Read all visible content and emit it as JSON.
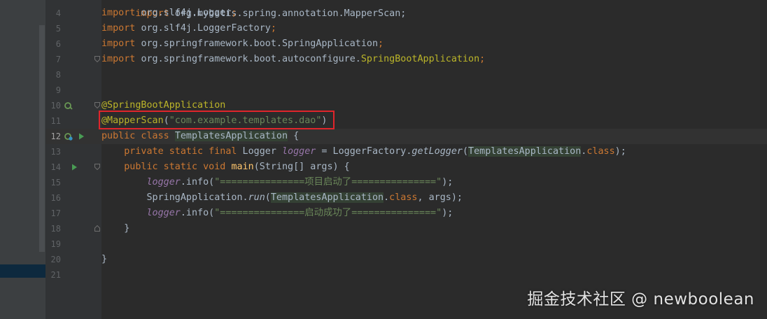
{
  "editor": {
    "lines": [
      {
        "num": "4",
        "tokens": [
          {
            "t": "import ",
            "c": "kw"
          },
          {
            "t": "org.slf4j.Logger",
            "c": ""
          },
          {
            "t": ";",
            "c": "kw"
          }
        ]
      },
      {
        "num": "5",
        "tokens": [
          {
            "t": "import ",
            "c": "kw"
          },
          {
            "t": "org.slf4j.LoggerFactory",
            "c": ""
          },
          {
            "t": ";",
            "c": "kw"
          }
        ]
      },
      {
        "num": "6",
        "tokens": [
          {
            "t": "import ",
            "c": "kw"
          },
          {
            "t": "org.springframework.boot.SpringApplication",
            "c": ""
          },
          {
            "t": ";",
            "c": "kw"
          }
        ]
      },
      {
        "num": "7",
        "tokens": [
          {
            "t": "import ",
            "c": "kw"
          },
          {
            "t": "org.springframework.boot.autoconfigure.",
            "c": ""
          },
          {
            "t": "SpringBootApplication",
            "c": "ann"
          },
          {
            "t": ";",
            "c": "kw"
          }
        ]
      },
      {
        "num": "8",
        "tokens": []
      },
      {
        "num": "9",
        "tokens": []
      },
      {
        "num": "10",
        "tokens": [
          {
            "t": "@SpringBootApplication",
            "c": "ann"
          }
        ]
      },
      {
        "num": "11",
        "tokens": [
          {
            "t": "@MapperScan",
            "c": "ann"
          },
          {
            "t": "(",
            "c": ""
          },
          {
            "t": "\"com.example.templates.dao\"",
            "c": "str"
          },
          {
            "t": ")",
            "c": ""
          }
        ]
      },
      {
        "num": "12",
        "tokens": [
          {
            "t": "public class ",
            "c": "kw"
          },
          {
            "t": "TemplatesApplication",
            "c": "hl"
          },
          {
            "t": " {",
            "c": ""
          }
        ]
      },
      {
        "num": "13",
        "tokens": [
          {
            "t": "    private static final ",
            "c": "kw"
          },
          {
            "t": "Logger ",
            "c": ""
          },
          {
            "t": "logger",
            "c": "fld"
          },
          {
            "t": " = LoggerFactory.",
            "c": ""
          },
          {
            "t": "getLogger",
            "c": "it"
          },
          {
            "t": "(",
            "c": ""
          },
          {
            "t": "TemplatesApplication",
            "c": "hl"
          },
          {
            "t": ".",
            "c": ""
          },
          {
            "t": "class",
            "c": "kw"
          },
          {
            "t": ");",
            "c": ""
          }
        ]
      },
      {
        "num": "14",
        "tokens": [
          {
            "t": "    public static void ",
            "c": "kw"
          },
          {
            "t": "main",
            "c": "fn"
          },
          {
            "t": "(String[] args) {",
            "c": ""
          }
        ]
      },
      {
        "num": "15",
        "tokens": [
          {
            "t": "        ",
            "c": ""
          },
          {
            "t": "logger",
            "c": "fld"
          },
          {
            "t": ".info(",
            "c": ""
          },
          {
            "t": "\"===============项目启动了===============\"",
            "c": "str"
          },
          {
            "t": ");",
            "c": ""
          }
        ]
      },
      {
        "num": "16",
        "tokens": [
          {
            "t": "        SpringApplication.",
            "c": ""
          },
          {
            "t": "run",
            "c": "it"
          },
          {
            "t": "(",
            "c": ""
          },
          {
            "t": "TemplatesApplication",
            "c": "hl"
          },
          {
            "t": ".",
            "c": ""
          },
          {
            "t": "class",
            "c": "kw"
          },
          {
            "t": ", args);",
            "c": ""
          }
        ]
      },
      {
        "num": "17",
        "tokens": [
          {
            "t": "        ",
            "c": ""
          },
          {
            "t": "logger",
            "c": "fld"
          },
          {
            "t": ".info(",
            "c": ""
          },
          {
            "t": "\"===============启动成功了===============\"",
            "c": "str"
          },
          {
            "t": ");",
            "c": ""
          }
        ]
      },
      {
        "num": "18",
        "tokens": [
          {
            "t": "    }",
            "c": ""
          }
        ]
      },
      {
        "num": "19",
        "tokens": []
      },
      {
        "num": "20",
        "tokens": [
          {
            "t": "}",
            "c": ""
          }
        ]
      },
      {
        "num": "21",
        "tokens": []
      }
    ],
    "partial_top_line": "import org.mybatis.spring.annotation.MapperScan;"
  },
  "watermark": "掘金技术社区 @ newboolean",
  "colors": {
    "highlight_box": "#e0252b",
    "keyword": "#cc7832",
    "annotation": "#bbb529",
    "string": "#6a8759"
  }
}
